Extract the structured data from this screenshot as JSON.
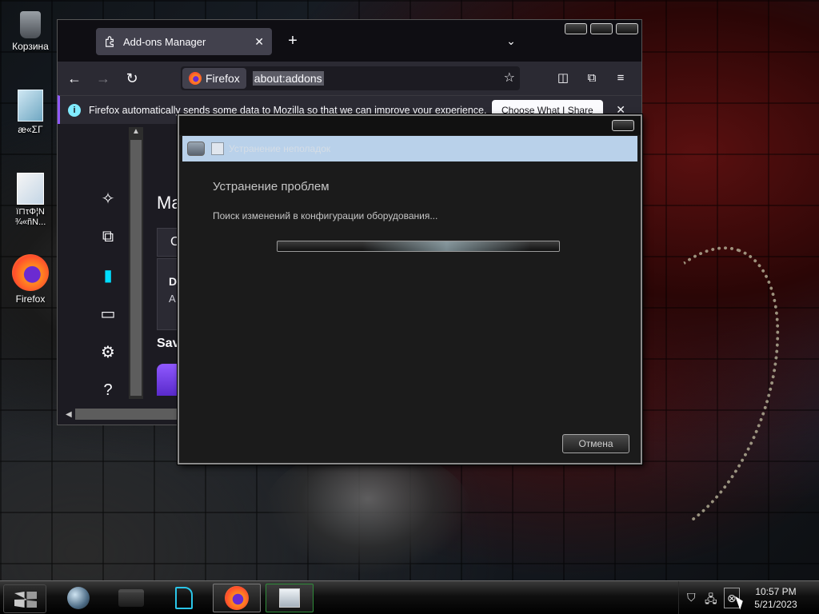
{
  "desktop": {
    "icons": [
      {
        "label": "Корзина"
      },
      {
        "label": "æ«ΣΓ"
      },
      {
        "label": "ï⊓τΦ¦N ¾«ñN..."
      },
      {
        "label": "Firefox"
      }
    ]
  },
  "firefox": {
    "tab": {
      "label": "Add-ons Manager",
      "close": "✕"
    },
    "new_tab": "+",
    "tab_list": "⌄",
    "nav": {
      "back": "←",
      "forward": "→",
      "reload": "↻"
    },
    "urlbar": {
      "identity": "Firefox",
      "url": "about:addons",
      "star": "☆"
    },
    "toolbar": {
      "pocket": "◫",
      "extensions": "⧉",
      "menu": "≡"
    },
    "notice": {
      "text": "Firefox automatically sends some data to Mozilla so that we can improve your experience.",
      "button": "Choose What I Share",
      "close": "✕"
    },
    "addons": {
      "heading": "Ma",
      "card_letter": "D",
      "card_sub": "A",
      "card_top": "C",
      "save": "Sav"
    }
  },
  "dialog": {
    "wizard_title": "Устранение неполадок",
    "heading": "Устранение проблем",
    "status": "Поиск изменений в конфигурации оборудования...",
    "progress": 0.6,
    "cancel": "Отмена"
  },
  "taskbar": {
    "clock_time": "10:57 PM",
    "clock_date": "5/21/2023"
  }
}
